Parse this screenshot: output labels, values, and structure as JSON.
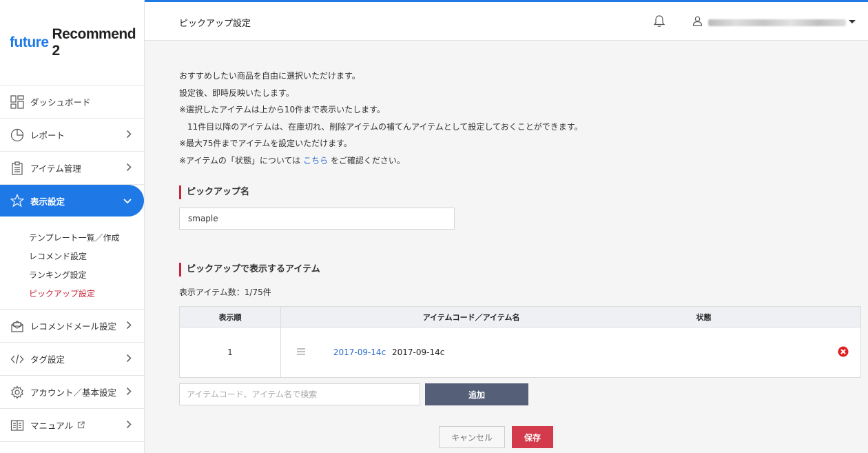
{
  "brand": {
    "part1": "future",
    "part2": "Recommend 2"
  },
  "sidebar": {
    "items": [
      {
        "label": "ダッシュボード",
        "icon": "dashboard-icon"
      },
      {
        "label": "レポート",
        "icon": "pie-chart-icon"
      },
      {
        "label": "アイテム管理",
        "icon": "clipboard-icon"
      },
      {
        "label": "表示設定",
        "icon": "star-icon"
      },
      {
        "label": "レコメンドメール設定",
        "icon": "mail-icon"
      },
      {
        "label": "タグ設定",
        "icon": "code-icon"
      },
      {
        "label": "アカウント／基本設定",
        "icon": "gear-icon"
      },
      {
        "label": "マニュアル",
        "icon": "book-icon"
      }
    ],
    "subitems": [
      "テンプレート一覧／作成",
      "レコメンド設定",
      "ランキング設定",
      "ピックアップ設定"
    ]
  },
  "header": {
    "title": "ピックアップ設定"
  },
  "description": {
    "line1": "おすすめしたい商品を自由に選択いただけます。",
    "line2": "設定後、即時反映いたします。",
    "line3": "※選択したアイテムは上から10件まで表示いたします。",
    "line4": "　11件目以降のアイテムは、在庫切れ、削除アイテムの補てんアイテムとして設定しておくことができます。",
    "line5": "※最大75件までアイテムを設定いただけます。",
    "line6_pre": "※アイテムの「状態」については ",
    "line6_link": "こちら",
    "line6_post": " をご確認ください。"
  },
  "pickup_name": {
    "heading": "ピックアップ名",
    "value": "smaple"
  },
  "items_section": {
    "heading": "ピックアップで表示するアイテム",
    "count": "表示アイテム数：1/75件",
    "columns": {
      "order": "表示順",
      "code_name": "アイテムコード／アイテム名",
      "status": "状態"
    },
    "rows": [
      {
        "order": "1",
        "code": "2017-09-14c",
        "name": "2017-09-14c"
      }
    ]
  },
  "search": {
    "placeholder": "アイテムコード、アイテム名で検索",
    "add_label": "追加"
  },
  "actions": {
    "cancel": "キャンセル",
    "save": "保存"
  },
  "colors": {
    "accent": "#1e78e6",
    "highlight": "#c8243a",
    "save": "#d33a4c",
    "add": "#556078"
  }
}
